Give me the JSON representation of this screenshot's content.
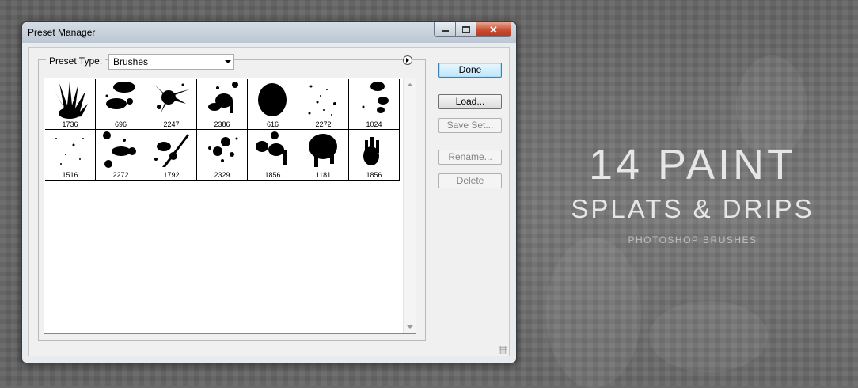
{
  "window": {
    "title": "Preset Manager"
  },
  "preset_type": {
    "label": "Preset Type:",
    "value": "Brushes"
  },
  "buttons": {
    "done": "Done",
    "load": "Load...",
    "save_set": "Save Set...",
    "rename": "Rename...",
    "delete": "Delete"
  },
  "brushes": [
    {
      "size": "1736",
      "icon": "spiky-burst-brush"
    },
    {
      "size": "696",
      "icon": "blob-splat-brush"
    },
    {
      "size": "2247",
      "icon": "splash-brush"
    },
    {
      "size": "2386",
      "icon": "drip-splat-brush"
    },
    {
      "size": "616",
      "icon": "round-blot-brush"
    },
    {
      "size": "2272",
      "icon": "speckle-brush"
    },
    {
      "size": "1024",
      "icon": "drops-brush"
    },
    {
      "size": "1516",
      "icon": "fine-speckle-brush"
    },
    {
      "size": "2272",
      "icon": "splatter-brush"
    },
    {
      "size": "1792",
      "icon": "streak-splat-brush"
    },
    {
      "size": "2329",
      "icon": "spatter-brush"
    },
    {
      "size": "1856",
      "icon": "dripping-blob-brush"
    },
    {
      "size": "1181",
      "icon": "large-drip-brush"
    },
    {
      "size": "1856",
      "icon": "hand-splat-brush"
    }
  ],
  "promo": {
    "line1": "14 PAINT",
    "line2": "SPLATS & DRIPS",
    "line3": "PHOTOSHOP BRUSHES"
  },
  "colors": {
    "background": "#6b6b6b",
    "default_button": "#bee6fd",
    "close_button": "#c94c33"
  }
}
